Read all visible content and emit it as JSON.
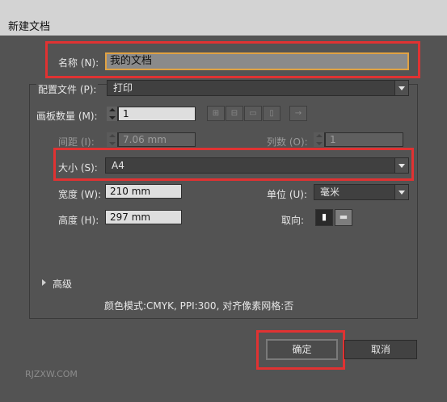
{
  "window": {
    "title": "新建文档"
  },
  "name": {
    "label": "名称 (N):",
    "value": "我的文档"
  },
  "profile": {
    "label": "配置文件 (P):",
    "value": "打印"
  },
  "artboards": {
    "count_label": "画板数量 (M):",
    "count_value": "1",
    "spacing_label": "间距 (I):",
    "spacing_value": "7.06 mm",
    "columns_label": "列数 (O):",
    "columns_value": "1",
    "arrow_glyph": "→"
  },
  "size": {
    "label": "大小 (S):",
    "value": "A4"
  },
  "width": {
    "label": "宽度 (W):",
    "value": "210 mm"
  },
  "height": {
    "label": "高度 (H):",
    "value": "297 mm"
  },
  "units": {
    "label": "单位 (U):",
    "value": "毫米"
  },
  "orientation": {
    "label": "取向:"
  },
  "advanced": {
    "label": "高级"
  },
  "summary": "颜色模式:CMYK, PPI:300, 对齐像素网格:否",
  "buttons": {
    "ok": "确定",
    "cancel": "取消"
  },
  "watermark": "RJZXW.COM",
  "colors": {
    "highlight": "#e03232",
    "dialog_bg": "#535353",
    "title_bg": "#d3d3d3"
  }
}
